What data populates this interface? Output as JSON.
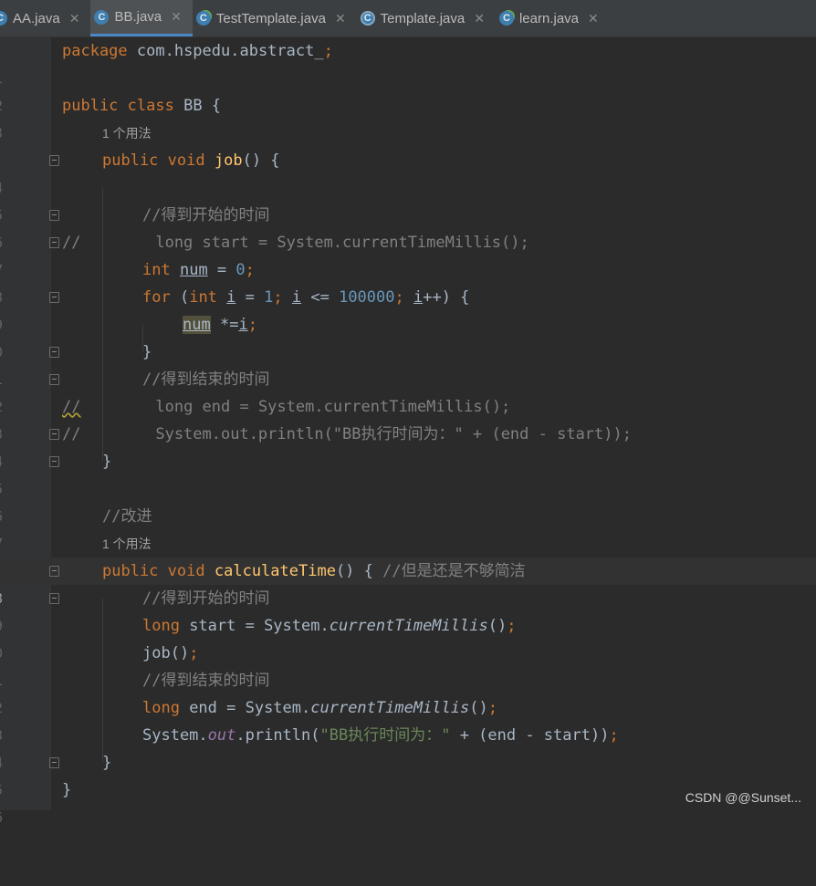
{
  "tabs": [
    {
      "label": "AA.java",
      "icon": "class-icon",
      "glyph": "C",
      "close": "✕"
    },
    {
      "label": "BB.java",
      "icon": "class-icon",
      "glyph": "C",
      "close": "✕"
    },
    {
      "label": "TestTemplate.java",
      "icon": "class-executable-icon",
      "glyph": "C",
      "close": "✕"
    },
    {
      "label": "Template.java",
      "icon": "abstract-class-icon",
      "glyph": "C",
      "close": "✕"
    },
    {
      "label": "learn.java",
      "icon": "class-executable-icon",
      "glyph": "C",
      "close": "✕"
    }
  ],
  "active_tab": "BB.java",
  "line_numbers": [
    "1",
    "2",
    "3",
    "",
    "4",
    "5",
    "6",
    "7",
    "8",
    "9",
    "0",
    "1",
    "2",
    "3",
    "4",
    "5",
    "6",
    "7",
    "",
    "8",
    "9",
    "0",
    "1",
    "2",
    "3",
    "4",
    "5",
    "6"
  ],
  "code": {
    "l1_kw": "package",
    "l1_rest": " com.hspedu.abstract_",
    "l1_semi": ";",
    "l3_kw1": "public",
    "l3_kw2": "class",
    "l3_rest": " BB {",
    "usage_hint_1": "1 个用法",
    "l4_kw1": "public",
    "l4_kw2": "void",
    "l4_fn": "job",
    "l4_rest": "() {",
    "l6_cmt": "//得到开始的时间",
    "l7_cmt": "//        long start = System.currentTimeMillis();",
    "l8_kw": "int",
    "l8_var": "num",
    "l8_eq": " = ",
    "l8_num": "0",
    "l8_semi": ";",
    "l9_kw1": "for",
    "l9_p1": " (",
    "l9_kw2": "int",
    "l9_var1": "i",
    "l9_eq": " = ",
    "l9_n1": "1",
    "l9_s1": "; ",
    "l9_var2": "i",
    "l9_le": " <= ",
    "l9_n2": "100000",
    "l9_s2": "; ",
    "l9_var3": "i",
    "l9_end": "++) {",
    "l10_var": "num",
    "l10_op": " *=",
    "l10_var2": "i",
    "l10_semi": ";",
    "l11_brace": "}",
    "l12_cmt": "//得到结束的时间",
    "l13_slash": "//",
    "l13_rest": "        long end = System.currentTimeMillis();",
    "l14_cmt": "//        System.out.println(\"BB执行时间为：\" + (end - start));",
    "l15_brace": "}",
    "l17_cmt": "//改进",
    "usage_hint_2": "1 个用法",
    "l18_kw1": "public",
    "l18_kw2": "void",
    "l18_fn": "calculateTime",
    "l18_rest": "() { ",
    "l18_cmt": "//但是还是不够简洁",
    "l19_cmt": "//得到开始的时间",
    "l20_kw": "long",
    "l20_mid": " start = System.",
    "l20_method": "currentTimeMillis",
    "l20_end": "()",
    "l20_semi": ";",
    "l21_call": "job()",
    "l21_semi": ";",
    "l22_cmt": "//得到结束的时间",
    "l23_kw": "long",
    "l23_mid": " end = System.",
    "l23_method": "currentTimeMillis",
    "l23_end": "()",
    "l23_semi": ";",
    "l24_pre": "System.",
    "l24_field": "out",
    "l24_mid": ".println(",
    "l24_str": "\"BB执行时间为：\"",
    "l24_rest": " + (end - start))",
    "l24_semi": ";",
    "l25_brace": "}",
    "l26_brace": "}"
  },
  "watermark": "CSDN @@Sunset...",
  "colors": {
    "background": "#2b2b2b",
    "keyword": "#cc7832",
    "number": "#6897bb",
    "string": "#6a8759",
    "function": "#ffc66d",
    "comment": "#808080",
    "field": "#9876aa",
    "tab_accent": "#4a88c7"
  }
}
